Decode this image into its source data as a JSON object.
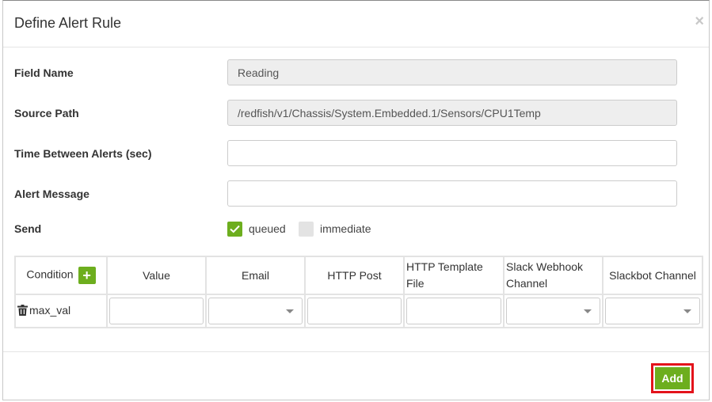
{
  "dialog": {
    "title": "Define Alert Rule",
    "close_symbol": "×"
  },
  "form": {
    "field_name": {
      "label": "Field Name",
      "value": "Reading"
    },
    "source_path": {
      "label": "Source Path",
      "value": "/redfish/v1/Chassis/System.Embedded.1/Sensors/CPU1Temp"
    },
    "time_between": {
      "label": "Time Between Alerts (sec)",
      "value": ""
    },
    "alert_message": {
      "label": "Alert Message",
      "value": ""
    },
    "send": {
      "label": "Send",
      "options": [
        {
          "label": "queued",
          "checked": true
        },
        {
          "label": "immediate",
          "checked": false
        }
      ]
    }
  },
  "conditions_table": {
    "headers": [
      "Condition",
      "Value",
      "Email",
      "HTTP Post",
      "HTTP Template File",
      "Slack Webhook Channel",
      "Slackbot Channel"
    ],
    "add_symbol": "+",
    "rows": [
      {
        "condition": "max_val",
        "value": "",
        "email": "",
        "http_post": "",
        "http_template_file": "",
        "slack_webhook_channel": "",
        "slackbot_channel": ""
      }
    ]
  },
  "footer": {
    "add_label": "Add"
  },
  "colors": {
    "accent_green": "#6dae1e",
    "highlight_red": "#e3131b"
  }
}
